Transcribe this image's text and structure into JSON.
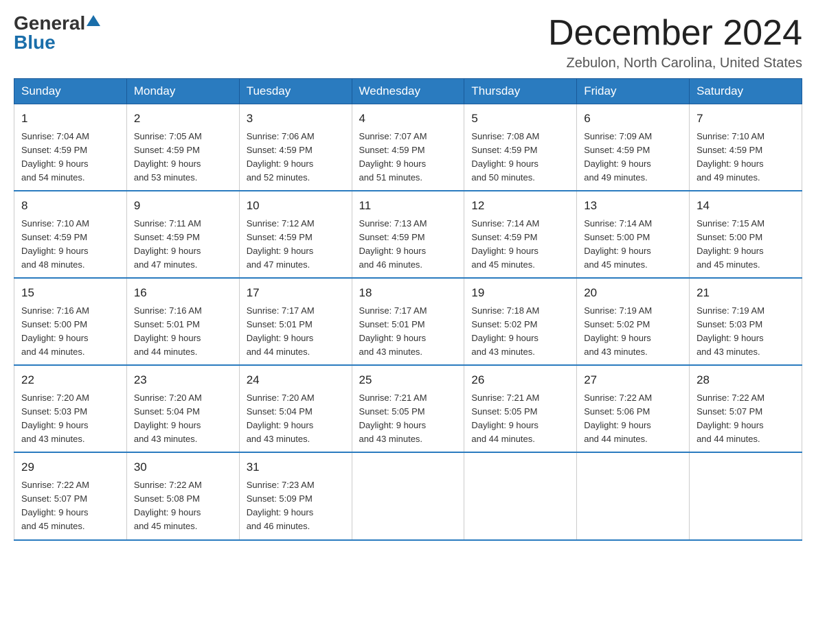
{
  "logo": {
    "general": "General",
    "blue": "Blue"
  },
  "header": {
    "month": "December 2024",
    "location": "Zebulon, North Carolina, United States"
  },
  "weekdays": [
    "Sunday",
    "Monday",
    "Tuesday",
    "Wednesday",
    "Thursday",
    "Friday",
    "Saturday"
  ],
  "weeks": [
    [
      {
        "day": "1",
        "sunrise": "7:04 AM",
        "sunset": "4:59 PM",
        "daylight": "9 hours and 54 minutes."
      },
      {
        "day": "2",
        "sunrise": "7:05 AM",
        "sunset": "4:59 PM",
        "daylight": "9 hours and 53 minutes."
      },
      {
        "day": "3",
        "sunrise": "7:06 AM",
        "sunset": "4:59 PM",
        "daylight": "9 hours and 52 minutes."
      },
      {
        "day": "4",
        "sunrise": "7:07 AM",
        "sunset": "4:59 PM",
        "daylight": "9 hours and 51 minutes."
      },
      {
        "day": "5",
        "sunrise": "7:08 AM",
        "sunset": "4:59 PM",
        "daylight": "9 hours and 50 minutes."
      },
      {
        "day": "6",
        "sunrise": "7:09 AM",
        "sunset": "4:59 PM",
        "daylight": "9 hours and 49 minutes."
      },
      {
        "day": "7",
        "sunrise": "7:10 AM",
        "sunset": "4:59 PM",
        "daylight": "9 hours and 49 minutes."
      }
    ],
    [
      {
        "day": "8",
        "sunrise": "7:10 AM",
        "sunset": "4:59 PM",
        "daylight": "9 hours and 48 minutes."
      },
      {
        "day": "9",
        "sunrise": "7:11 AM",
        "sunset": "4:59 PM",
        "daylight": "9 hours and 47 minutes."
      },
      {
        "day": "10",
        "sunrise": "7:12 AM",
        "sunset": "4:59 PM",
        "daylight": "9 hours and 47 minutes."
      },
      {
        "day": "11",
        "sunrise": "7:13 AM",
        "sunset": "4:59 PM",
        "daylight": "9 hours and 46 minutes."
      },
      {
        "day": "12",
        "sunrise": "7:14 AM",
        "sunset": "4:59 PM",
        "daylight": "9 hours and 45 minutes."
      },
      {
        "day": "13",
        "sunrise": "7:14 AM",
        "sunset": "5:00 PM",
        "daylight": "9 hours and 45 minutes."
      },
      {
        "day": "14",
        "sunrise": "7:15 AM",
        "sunset": "5:00 PM",
        "daylight": "9 hours and 45 minutes."
      }
    ],
    [
      {
        "day": "15",
        "sunrise": "7:16 AM",
        "sunset": "5:00 PM",
        "daylight": "9 hours and 44 minutes."
      },
      {
        "day": "16",
        "sunrise": "7:16 AM",
        "sunset": "5:01 PM",
        "daylight": "9 hours and 44 minutes."
      },
      {
        "day": "17",
        "sunrise": "7:17 AM",
        "sunset": "5:01 PM",
        "daylight": "9 hours and 44 minutes."
      },
      {
        "day": "18",
        "sunrise": "7:17 AM",
        "sunset": "5:01 PM",
        "daylight": "9 hours and 43 minutes."
      },
      {
        "day": "19",
        "sunrise": "7:18 AM",
        "sunset": "5:02 PM",
        "daylight": "9 hours and 43 minutes."
      },
      {
        "day": "20",
        "sunrise": "7:19 AM",
        "sunset": "5:02 PM",
        "daylight": "9 hours and 43 minutes."
      },
      {
        "day": "21",
        "sunrise": "7:19 AM",
        "sunset": "5:03 PM",
        "daylight": "9 hours and 43 minutes."
      }
    ],
    [
      {
        "day": "22",
        "sunrise": "7:20 AM",
        "sunset": "5:03 PM",
        "daylight": "9 hours and 43 minutes."
      },
      {
        "day": "23",
        "sunrise": "7:20 AM",
        "sunset": "5:04 PM",
        "daylight": "9 hours and 43 minutes."
      },
      {
        "day": "24",
        "sunrise": "7:20 AM",
        "sunset": "5:04 PM",
        "daylight": "9 hours and 43 minutes."
      },
      {
        "day": "25",
        "sunrise": "7:21 AM",
        "sunset": "5:05 PM",
        "daylight": "9 hours and 43 minutes."
      },
      {
        "day": "26",
        "sunrise": "7:21 AM",
        "sunset": "5:05 PM",
        "daylight": "9 hours and 44 minutes."
      },
      {
        "day": "27",
        "sunrise": "7:22 AM",
        "sunset": "5:06 PM",
        "daylight": "9 hours and 44 minutes."
      },
      {
        "day": "28",
        "sunrise": "7:22 AM",
        "sunset": "5:07 PM",
        "daylight": "9 hours and 44 minutes."
      }
    ],
    [
      {
        "day": "29",
        "sunrise": "7:22 AM",
        "sunset": "5:07 PM",
        "daylight": "9 hours and 45 minutes."
      },
      {
        "day": "30",
        "sunrise": "7:22 AM",
        "sunset": "5:08 PM",
        "daylight": "9 hours and 45 minutes."
      },
      {
        "day": "31",
        "sunrise": "7:23 AM",
        "sunset": "5:09 PM",
        "daylight": "9 hours and 46 minutes."
      },
      null,
      null,
      null,
      null
    ]
  ],
  "labels": {
    "sunrise": "Sunrise:",
    "sunset": "Sunset:",
    "daylight": "Daylight:"
  }
}
